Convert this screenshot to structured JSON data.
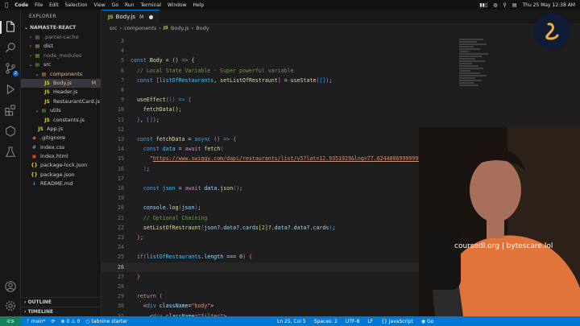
{
  "menubar": {
    "app": "Code",
    "items": [
      "File",
      "Edit",
      "Selection",
      "View",
      "Go",
      "Run",
      "Terminal",
      "Window",
      "Help"
    ],
    "clock": "Thu 25 May  12:38 AM"
  },
  "explorer": {
    "title": "EXPLORER",
    "root": "NAMASTE-REACT",
    "items": [
      {
        "label": ".parcel-cache",
        "icon": "folder"
      },
      {
        "label": "dist",
        "icon": "folder"
      },
      {
        "label": "node_modules",
        "icon": "folder"
      },
      {
        "label": "src",
        "icon": "folder-open"
      },
      {
        "label": "components",
        "icon": "folder-open"
      },
      {
        "label": "Body.js",
        "icon": "js",
        "modified": "M"
      },
      {
        "label": "Header.js",
        "icon": "js"
      },
      {
        "label": "RestaurantCard.js",
        "icon": "js"
      },
      {
        "label": "utils",
        "icon": "folder-open"
      },
      {
        "label": "constants.js",
        "icon": "js"
      },
      {
        "label": "App.js",
        "icon": "js"
      },
      {
        "label": ".gitignore",
        "icon": "git"
      },
      {
        "label": "index.css",
        "icon": "css"
      },
      {
        "label": "index.html",
        "icon": "html"
      },
      {
        "label": "package-lock.json",
        "icon": "json"
      },
      {
        "label": "package.json",
        "icon": "json"
      },
      {
        "label": "README.md",
        "icon": "md"
      }
    ],
    "outline": "OUTLINE",
    "timeline": "TIMELINE"
  },
  "editor": {
    "tab": {
      "icon": "JS",
      "label": "Body.js",
      "modified": "M"
    },
    "breadcrumb": {
      "part1": "src",
      "part2": "components",
      "part3": "Body.js",
      "part4": "Body"
    }
  },
  "statusbar": {
    "branch": "main*",
    "errors": "0",
    "warnings": "0",
    "tabnine": "tabnine starter",
    "position": "Ln 25, Col 5",
    "spaces": "Spaces: 2",
    "encoding": "UTF-8",
    "lang": "JavaScript",
    "golive": "Go"
  },
  "overlay": {
    "watermark": "coursedl.org | bytescare.lol"
  },
  "colors": {
    "status_bar": "#0078d4",
    "editor_bg": "#1e1e1e",
    "sidebar_bg": "#181818"
  }
}
